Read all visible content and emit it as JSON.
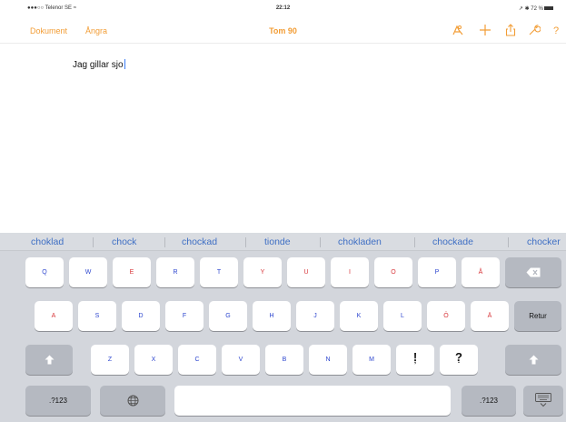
{
  "status_bar": {
    "carrier": "●●●○○ Telenor SE ≈",
    "time": "22:12",
    "battery": "↗ ✱ 72 %"
  },
  "nav": {
    "document_label": "Dokument",
    "undo_label": "Ångra",
    "title": "Tom 90",
    "icons": [
      "format-paintbrush-icon",
      "plus-icon",
      "share-icon",
      "wrench-icon",
      "help-icon"
    ],
    "accent_color": "#f29d36"
  },
  "document": {
    "text": "Jag gillar sjo"
  },
  "keyboard": {
    "suggestions": [
      "choklad",
      "chock",
      "chockad",
      "tionde",
      "chokladen",
      "chockade",
      "chocker"
    ],
    "row1": [
      "Q",
      "W",
      "E",
      "R",
      "T",
      "Y",
      "U",
      "I",
      "O",
      "P",
      "Å"
    ],
    "row2": [
      "A",
      "S",
      "D",
      "F",
      "G",
      "H",
      "J",
      "K",
      "L",
      "Ö",
      "Ä"
    ],
    "row3": [
      "Z",
      "X",
      "C",
      "V",
      "B",
      "N",
      "M",
      "!",
      "?"
    ],
    "row3_sub": [
      ",",
      "."
    ],
    "return_label": "Retur",
    "numbers_label": ".?123",
    "icons": [
      "backspace-icon",
      "shift-icon",
      "globe-icon",
      "keyboard-dismiss-icon"
    ],
    "vowel_color": "#d8363a",
    "consonant_color": "#2e47cf"
  }
}
